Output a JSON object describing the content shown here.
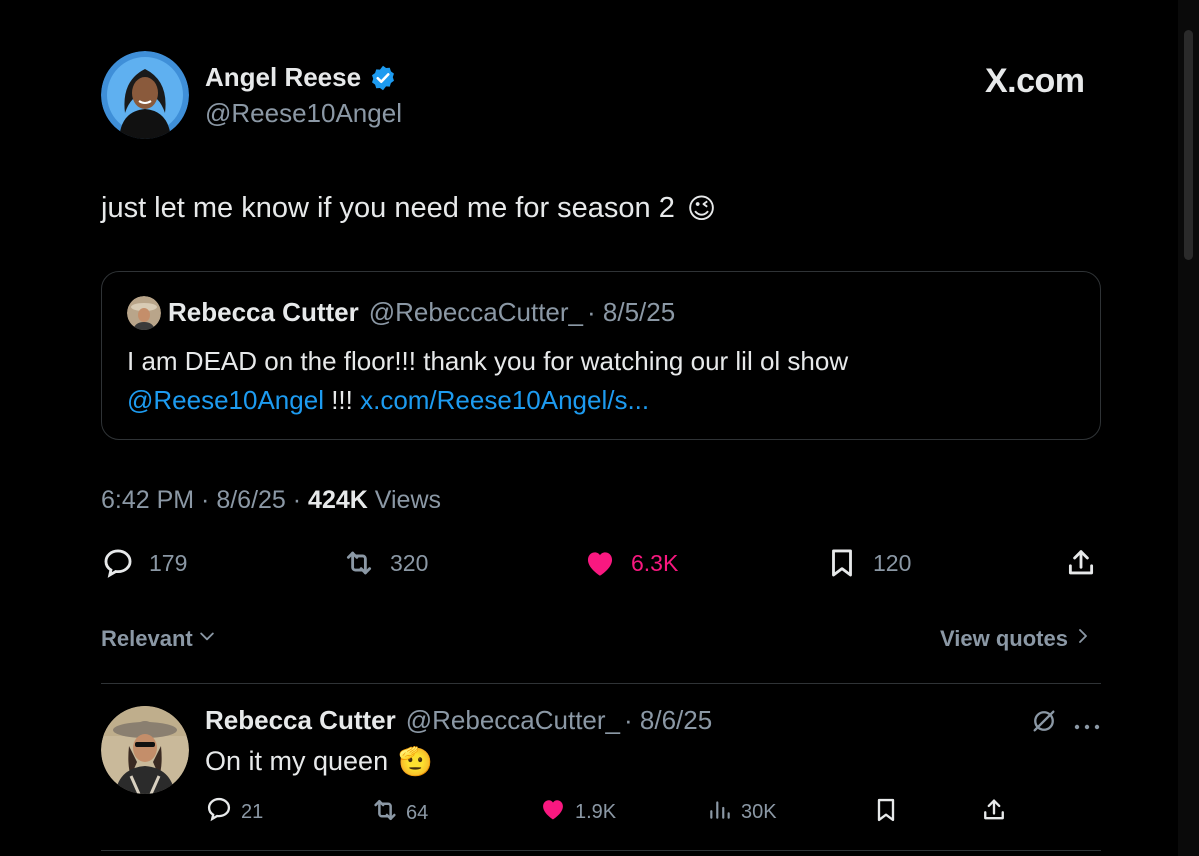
{
  "brand": "X.com",
  "colors": {
    "background": "#000000",
    "accent": "#1d9bf0",
    "like": "#f91880",
    "muted": "#8b98a5",
    "verified": "#1d9bf0"
  },
  "tweet": {
    "author_name": "Angel Reese",
    "author_handle": "@Reese10Angel",
    "verified": true,
    "text": "just let me know if you need me for season 2",
    "emoji": "😉",
    "timestamp": "6:42 PM · 8/6/25 · ",
    "views_count": "424K",
    "views_label": " Views",
    "stats": {
      "replies": "179",
      "reposts": "320",
      "likes": "6.3K",
      "bookmarks": "120"
    },
    "icons": [
      "reply-icon",
      "repost-icon",
      "heart-icon",
      "bookmark-icon",
      "share-icon"
    ]
  },
  "quote": {
    "author_name": "Rebecca Cutter",
    "author_handle": "@RebeccaCutter_",
    "date": "· 8/5/25",
    "text_line1": "I am DEAD on the floor!!! thank you for watching our lil ol show",
    "mention": "@Reese10Angel",
    "text_mid": " !!! ",
    "link": "x.com/Reese10Angel/s..."
  },
  "sort": {
    "label": "Relevant",
    "view_quotes": "View quotes"
  },
  "reply": {
    "author_name": "Rebecca Cutter",
    "author_handle": "@RebeccaCutter_",
    "date": "· 8/6/25",
    "text": "On it my queen",
    "emoji": "🫡",
    "stats": {
      "replies": "21",
      "reposts": "64",
      "likes": "1.9K",
      "views": "30K"
    }
  }
}
